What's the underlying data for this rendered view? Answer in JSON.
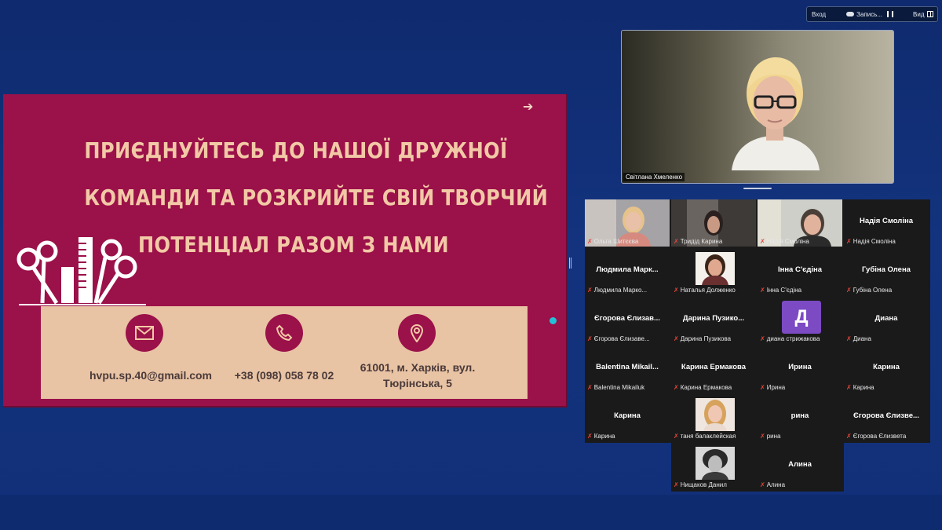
{
  "toolbar": {
    "enter_label": "Вход",
    "record_label": "Запись...",
    "view_label": "Вид"
  },
  "slide": {
    "title_lines": [
      "ПРИЄДНУЙТЕСЬ ДО НАШОЇ ДРУЖНОЇ",
      "КОМАНДИ ТА РОЗКРИЙТЕ СВІЙ ТВОРЧИЙ",
      "ПОТЕНЦІАЛ РАЗОМ З НАМИ"
    ],
    "email": "hvpu.sp.40@gmail.com",
    "phone": "+38 (098) 058 78 02",
    "address_line1": "61001, м. Харків, вул.",
    "address_line2": "Тюрінська, 5",
    "colors": {
      "background": "#9b1149",
      "title": "#f2c9a6",
      "box": "#e8c3a4"
    }
  },
  "speaker": {
    "name": "Світлана Хмеленко"
  },
  "participants": [
    {
      "tile_name": "",
      "tag": "Ольга Шитєєва",
      "kind": "video"
    },
    {
      "tile_name": "",
      "tag": "Тридід Карина",
      "kind": "video"
    },
    {
      "tile_name": "",
      "tag": "Надія Смоліна",
      "kind": "video"
    },
    {
      "tile_name": "Надія Смоліна",
      "tag": "Надія Смоліна",
      "kind": "name"
    },
    {
      "tile_name": "Людмила  Марк...",
      "tag": "Людмила Марко...",
      "kind": "name"
    },
    {
      "tile_name": "",
      "tag": "Наталья Долженко",
      "kind": "photo"
    },
    {
      "tile_name": "Інна С'єдіна",
      "tag": "Інна С'єдіна",
      "kind": "name"
    },
    {
      "tile_name": "Губіна Олена",
      "tag": "Губіна Олена",
      "kind": "name"
    },
    {
      "tile_name": "Єгорова Єлизав...",
      "tag": "Єгорова Єлизаве...",
      "kind": "name"
    },
    {
      "tile_name": "Дарина  Пузико...",
      "tag": "Дарина Пузикова",
      "kind": "name"
    },
    {
      "tile_name": "Д",
      "tag": "диана стрижакова",
      "kind": "initial"
    },
    {
      "tile_name": "Диана",
      "tag": "Диана",
      "kind": "name"
    },
    {
      "tile_name": "Balentina  Mikail...",
      "tag": "Balentina Mikailuk",
      "kind": "name"
    },
    {
      "tile_name": "Карина Ермакова",
      "tag": "Карина Ермакова",
      "kind": "name"
    },
    {
      "tile_name": "Ирина",
      "tag": "Ирина",
      "kind": "name"
    },
    {
      "tile_name": "Карина",
      "tag": "Карина",
      "kind": "name"
    },
    {
      "tile_name": "Карина",
      "tag": "Карина",
      "kind": "name"
    },
    {
      "tile_name": "",
      "tag": "таня балаклейская",
      "kind": "photo2"
    },
    {
      "tile_name": "рина",
      "tag": "рина",
      "kind": "name"
    },
    {
      "tile_name": "Єгорова Єлизве...",
      "tag": "Єгорова Єлизвета",
      "kind": "name"
    },
    {
      "tile_name": "",
      "tag": "Нищаков Данил",
      "kind": "photo3"
    },
    {
      "tile_name": "Алина",
      "tag": "Алина",
      "kind": "name"
    }
  ]
}
